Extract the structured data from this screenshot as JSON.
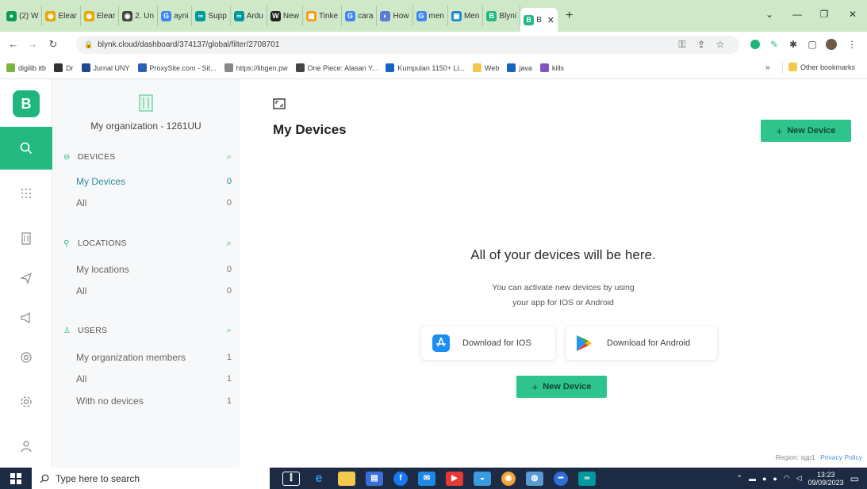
{
  "browser": {
    "tabs": [
      {
        "label": "(2) W",
        "color": "#0b9d58",
        "glyph": "●"
      },
      {
        "label": "Elear",
        "color": "#e8a500",
        "glyph": "◉"
      },
      {
        "label": "Elear",
        "color": "#e8a500",
        "glyph": "◉"
      },
      {
        "label": "2. Un",
        "color": "#444444",
        "glyph": "◉"
      },
      {
        "label": "ayni",
        "color": "#4285f4",
        "glyph": "G"
      },
      {
        "label": "Supp",
        "color": "#00979d",
        "glyph": "∞"
      },
      {
        "label": "Ardu",
        "color": "#00979d",
        "glyph": "∞"
      },
      {
        "label": "New",
        "color": "#222222",
        "glyph": "W"
      },
      {
        "label": "Tinke",
        "color": "#f39c12",
        "glyph": "▦"
      },
      {
        "label": "cara",
        "color": "#4285f4",
        "glyph": "G"
      },
      {
        "label": "How",
        "color": "#5b7bd5",
        "glyph": "◐"
      },
      {
        "label": "men",
        "color": "#4285f4",
        "glyph": "G"
      },
      {
        "label": "Men",
        "color": "#1e88c7",
        "glyph": "▣"
      },
      {
        "label": "Blyni",
        "color": "#23b981",
        "glyph": "B"
      }
    ],
    "active_tab": {
      "label": "B",
      "color": "#23b981",
      "glyph": "B"
    },
    "new_tab": "+",
    "url": "blynk.cloud/dashboard/374137/global/filter/2708701",
    "bookmarks": [
      {
        "label": "digilib itb",
        "color": "#7cb342"
      },
      {
        "label": "Dr",
        "color": "#333333"
      },
      {
        "label": "Jurnal UNY",
        "color": "#1e4b8f"
      },
      {
        "label": "ProxySite.com - Sit...",
        "color": "#2d5fb8"
      },
      {
        "label": "https://libgen.pw",
        "color": "#888888"
      },
      {
        "label": "One Piece: Alasan Y...",
        "color": "#444444"
      },
      {
        "label": "Kumpulan 1150+ Li...",
        "color": "#1565c0"
      },
      {
        "label": "Web",
        "color": "#f2c94c"
      },
      {
        "label": "java",
        "color": "#1565c0"
      },
      {
        "label": "kills",
        "color": "#7e57c2"
      }
    ],
    "more_bookmarks": "»",
    "other_bookmarks": "Other bookmarks"
  },
  "blynk": {
    "org_name": "My organization - 1261UU",
    "sections": {
      "devices": {
        "title": "DEVICES",
        "items": [
          {
            "label": "My Devices",
            "count": "0"
          },
          {
            "label": "All",
            "count": "0"
          }
        ]
      },
      "locations": {
        "title": "LOCATIONS",
        "items": [
          {
            "label": "My locations",
            "count": "0"
          },
          {
            "label": "All",
            "count": "0"
          }
        ]
      },
      "users": {
        "title": "USERS",
        "items": [
          {
            "label": "My organization members",
            "count": "1"
          },
          {
            "label": "All",
            "count": "1"
          },
          {
            "label": "With no devices",
            "count": "1"
          }
        ]
      }
    },
    "main": {
      "title": "My Devices",
      "new_device_label": "New Device",
      "plus": "+",
      "empty_title": "All of your devices will be here.",
      "empty_line1": "You can activate new devices by using",
      "empty_line2": "your app for IOS or Android",
      "download_ios": "Download for IOS",
      "download_android": "Download for Android",
      "region": "Region: sgp1",
      "privacy": "Privacy Policy"
    },
    "accent": "#23b981"
  },
  "taskbar": {
    "search_placeholder": "Type here to search",
    "time": "13:23",
    "date": "09/09/2023"
  }
}
